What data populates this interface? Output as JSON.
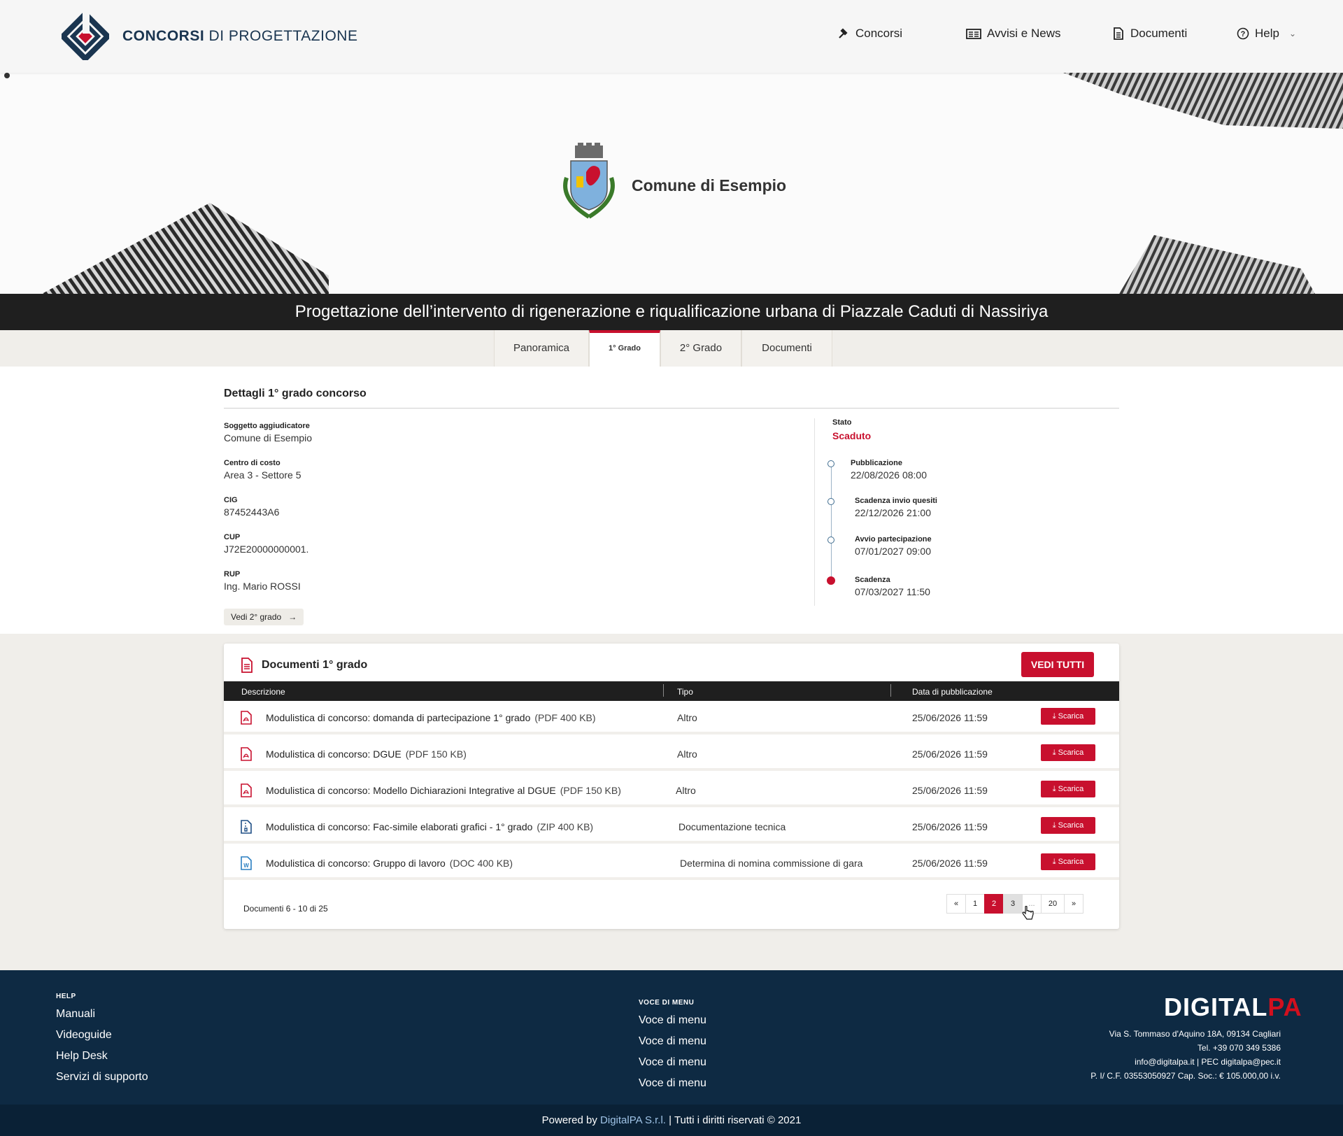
{
  "header": {
    "logo_bold": "CONCORSI",
    "logo_rest": " DI PROGETTAZIONE",
    "nav": [
      {
        "label": "Concorsi",
        "icon": "gavel-icon"
      },
      {
        "label": "Avvisi e News",
        "icon": "newspaper-icon"
      },
      {
        "label": "Documenti",
        "icon": "document-icon"
      },
      {
        "label": "Help",
        "icon": "help-circle-icon"
      }
    ]
  },
  "hero": {
    "org_name": "Comune di Esempio",
    "project_title": "Progettazione dell’intervento di rigenerazione e riqualificazione urbana di Piazzale Caduti di Nassiriya"
  },
  "tabs": [
    {
      "label": "Panoramica",
      "active": false
    },
    {
      "label": "1° Grado",
      "active": true
    },
    {
      "label": "2° Grado",
      "active": false
    },
    {
      "label": "Documenti",
      "active": false
    }
  ],
  "details": {
    "title": "Dettagli 1° grado concorso",
    "fields": [
      {
        "label": "Soggetto aggiudicatore",
        "value": "Comune di Esempio"
      },
      {
        "label": "Centro di costo",
        "value": "Area 3 - Settore 5"
      },
      {
        "label": "CIG",
        "value": "87452443A6"
      },
      {
        "label": "CUP",
        "value": "J72E20000000001."
      },
      {
        "label": "RUP",
        "value": "Ing. Mario ROSSI"
      }
    ],
    "vedi_button": "Vedi 2° grado",
    "status_label": "Stato",
    "status_value": "Scaduto",
    "timeline": [
      {
        "label": "Pubblicazione",
        "value": "22/08/2026  08:00"
      },
      {
        "label": "Scadenza invio quesiti",
        "value": "22/12/2026  21:00"
      },
      {
        "label": "Avvio partecipazione",
        "value": "07/01/2027  09:00"
      },
      {
        "label": "Scadenza",
        "value": "07/03/2027  11:50"
      }
    ]
  },
  "documents": {
    "title": "Documenti 1° grado",
    "vedi_tutti": "VEDI TUTTI",
    "columns": [
      "Descrizione",
      "Tipo",
      "Data di pubblicazione"
    ],
    "rows": [
      {
        "icon": "pdf-file-icon",
        "desc": "Modulistica di concorso: domanda di partecipazione 1° grado",
        "size": "(PDF 400 KB)",
        "tipo": "Altro",
        "data": "25/06/2026  11:59"
      },
      {
        "icon": "pdf-file-icon",
        "desc": "Modulistica di concorso: DGUE",
        "size": "(PDF 150 KB)",
        "tipo": "Altro",
        "data": "25/06/2026  11:59"
      },
      {
        "icon": "pdf-file-icon",
        "desc": "Modulistica di concorso: Modello Dichiarazioni Integrative al DGUE",
        "size": "(PDF 150 KB)",
        "tipo": "Altro",
        "data": "25/06/2026  11:59"
      },
      {
        "icon": "zip-file-icon",
        "desc": "Modulistica di concorso: Fac-simile elaborati grafici - 1° grado",
        "size": "(ZIP 400 KB)",
        "tipo": "Documentazione tecnica",
        "data": "25/06/2026  11:59"
      },
      {
        "icon": "word-file-icon",
        "desc": "Modulistica di concorso: Gruppo di lavoro",
        "size": "(DOC 400 KB)",
        "tipo": "Determina di nomina commissione di gara",
        "data": "25/06/2026  11:59"
      }
    ],
    "download_label": "Scarica",
    "count_text": "Documenti 6 - 10 di 25",
    "pager": [
      "«",
      "1",
      "2",
      "3",
      "...",
      "20",
      "»"
    ],
    "current_page": "2"
  },
  "footer": {
    "help_heading": "HELP",
    "help_links": [
      "Manuali",
      "Videoguide",
      "Help Desk",
      "Servizi di supporto"
    ],
    "menu_heading": "VOCE DI MENU",
    "menu_links": [
      "Voce di menu",
      "Voce di menu",
      "Voce di menu",
      "Voce di menu"
    ],
    "logo_digital": "DIGITAL",
    "logo_pa": "PA",
    "address": [
      "Via S. Tommaso d'Aquino 18A, 09134 Cagliari",
      "Tel. +39 070 349 5386",
      "info@digitalpa.it  |  PEC  digitalpa@pec.it",
      "P. I/ C.F. 03553050927 Cap. Soc.: € 105.000,00 i.v."
    ],
    "powered_by": "Powered by ",
    "brand": "DigitalPA S.r.l.",
    "rights": "  |   Tutti i diritti riservati ©  2021"
  },
  "colors": {
    "accent": "#c8102e",
    "footer_bg": "#0e2a43",
    "dark_bar": "#1f1f1f"
  }
}
